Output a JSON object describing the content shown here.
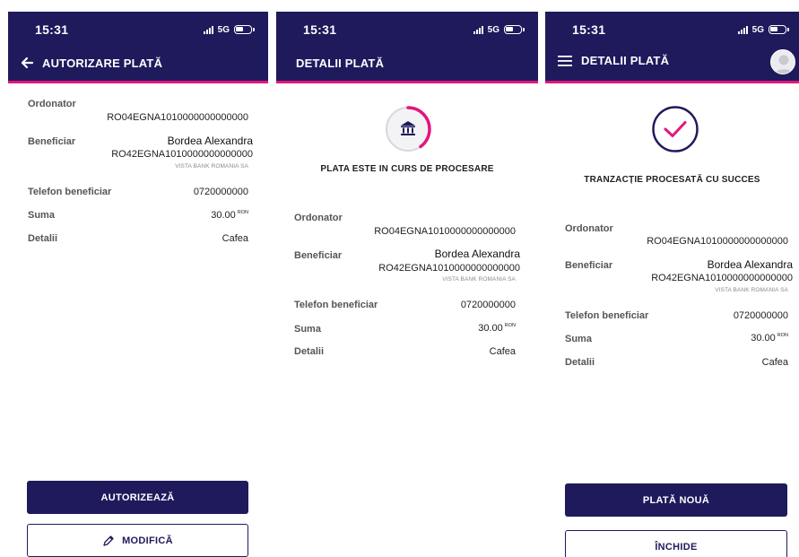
{
  "status_bar": {
    "time": "15:31",
    "network": "5G"
  },
  "currency": "RON",
  "screens": [
    {
      "header_title": "AUTORIZARE PLATĂ",
      "ordonator_label": "Ordonator",
      "ordonator_iban": "RO04EGNA1010000000000000",
      "beneficiar_label": "Beneficiar",
      "beneficiar_name": "Bordea Alexandra",
      "beneficiar_iban": "RO42EGNA1010000000000000",
      "beneficiar_bank": "VISTA BANK ROMANIA SA",
      "telefon_label": "Telefon beneficiar",
      "telefon_value": "0720000000",
      "suma_label": "Suma",
      "suma_value": "30.00",
      "detalii_label": "Detalii",
      "detalii_value": "Cafea",
      "primary_button": "AUTORIZEAZĂ",
      "secondary_button": "MODIFICĂ"
    },
    {
      "header_title": "DETALII PLATĂ",
      "status_message": "PLATA ESTE IN CURS DE PROCESARE",
      "processing_progress": 0.4,
      "ordonator_label": "Ordonator",
      "ordonator_iban": "RO04EGNA1010000000000000",
      "beneficiar_label": "Beneficiar",
      "beneficiar_name": "Bordea Alexandra",
      "beneficiar_iban": "RO42EGNA1010000000000000",
      "beneficiar_bank": "VISTA BANK ROMANIA SA",
      "telefon_label": "Telefon beneficiar",
      "telefon_value": "0720000000",
      "suma_label": "Suma",
      "suma_value": "30.00",
      "detalii_label": "Detalii",
      "detalii_value": "Cafea"
    },
    {
      "header_title": "DETALII PLATĂ",
      "status_message": "TRANZACȚIE PROCESATĂ CU SUCCES",
      "ordonator_label": "Ordonator",
      "ordonator_iban": "RO04EGNA1010000000000000",
      "beneficiar_label": "Beneficiar",
      "beneficiar_name": "Bordea Alexandra",
      "beneficiar_iban": "RO42EGNA1010000000000000",
      "beneficiar_bank": "VISTA BANK ROMANIA SA",
      "telefon_label": "Telefon beneficiar",
      "telefon_value": "0720000000",
      "suma_label": "Suma",
      "suma_value": "30.00",
      "detalii_label": "Detalii",
      "detalii_value": "Cafea",
      "primary_button": "PLATĂ NOUĂ",
      "secondary_button": "ÎNCHIDE"
    }
  ],
  "colors": {
    "brand": "#1f1a5c",
    "accent": "#e0177e"
  }
}
